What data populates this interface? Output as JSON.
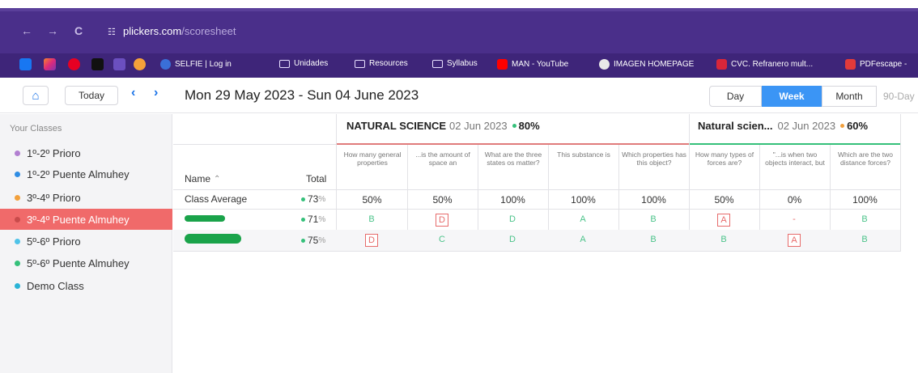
{
  "browser": {
    "url_host": "plickers.com",
    "url_path": "/scoresheet",
    "bookmarks": [
      {
        "label": "SELFIE | Log in",
        "icon": "globe-icon"
      },
      {
        "label": "Unidades",
        "icon": "folder-icon"
      },
      {
        "label": "Resources",
        "icon": "folder-icon"
      },
      {
        "label": "Syllabus",
        "icon": "folder-icon"
      },
      {
        "label": "MAN - YouTube",
        "icon": "youtube-icon"
      },
      {
        "label": "IMAGEN HOMEPAGE",
        "icon": "globe-icon"
      },
      {
        "label": "CVC. Refranero mult...",
        "icon": "cvc-icon"
      },
      {
        "label": "PDFescape -",
        "icon": "pdf-icon"
      }
    ]
  },
  "header": {
    "today_label": "Today",
    "date_range": "Mon 29 May 2023 - Sun 04 June 2023",
    "views": [
      "Day",
      "Week",
      "Month",
      "90-Day"
    ],
    "active_view": "Week"
  },
  "sidebar": {
    "title": "Your Classes",
    "classes": [
      {
        "label": "1º-2º Prioro",
        "color": "#b27fd1"
      },
      {
        "label": "1º-2º Puente Almuhey",
        "color": "#2f8de4"
      },
      {
        "label": "3º-4º Prioro",
        "color": "#f2a03d"
      },
      {
        "label": "3º-4º Puente Almuhey",
        "color": "#c94b4b",
        "selected": true
      },
      {
        "label": "5º-6º Prioro",
        "color": "#4fc3e8"
      },
      {
        "label": "5º-6º Puente Almuhey",
        "color": "#35c07a"
      },
      {
        "label": "Demo Class",
        "color": "#29b3d6"
      }
    ]
  },
  "table": {
    "name_header": "Name",
    "sort_indicator": "⌃",
    "total_header": "Total",
    "sets": [
      {
        "title": "NATURAL SCIENCE",
        "date": "02 Jun 2023",
        "score": "80%"
      },
      {
        "title": "Natural scien...",
        "date": "02 Jun 2023",
        "score": "60%"
      }
    ],
    "questions": [
      "How many general properties",
      "...is the amount of space an",
      "What are the three states os matter?",
      "This substance is",
      "Which properties has this object?",
      "How many types of forces are?",
      "\"...is when two objects interact, but",
      "Which are the two distance forces?"
    ],
    "average": {
      "label": "Class Average",
      "total": "73",
      "total_unit": "%",
      "values": [
        "50%",
        "50%",
        "100%",
        "100%",
        "100%",
        "50%",
        "0%",
        "100%"
      ]
    },
    "students": [
      {
        "total": "71",
        "total_unit": "%",
        "answers": [
          "B",
          "D",
          "D",
          "A",
          "B",
          "A",
          "-",
          "B"
        ],
        "wrong": [
          1,
          5
        ]
      },
      {
        "total": "75",
        "total_unit": "%",
        "answers": [
          "D",
          "C",
          "D",
          "A",
          "B",
          "B",
          "A",
          "B"
        ],
        "wrong": [
          0,
          6
        ]
      }
    ]
  }
}
